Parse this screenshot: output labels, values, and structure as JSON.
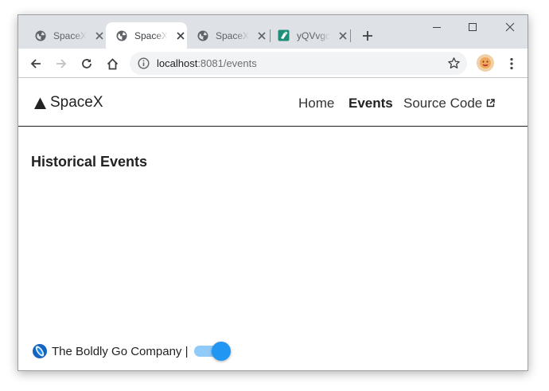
{
  "browser": {
    "tabs": [
      {
        "title": "SpaceX",
        "icon": "globe-icon",
        "active": false
      },
      {
        "title": "SpaceX",
        "icon": "globe-icon",
        "active": true
      },
      {
        "title": "SpaceX",
        "icon": "globe-icon",
        "active": false
      },
      {
        "title": "yQVvgc",
        "icon": "app-favicon-icon",
        "active": false
      }
    ],
    "url_host": "localhost",
    "url_rest": ":8081/events",
    "colors": {
      "tabstrip": "#dee1e6",
      "omnibox": "#f1f3f4"
    }
  },
  "site": {
    "brand": "SpaceX",
    "nav": [
      {
        "label": "Home",
        "active": false
      },
      {
        "label": "Events",
        "active": true
      },
      {
        "label": "Source Code",
        "active": false,
        "icon": "external-link-icon"
      }
    ],
    "heading": "Historical Events",
    "footer_text": "The Boldly Go Company |",
    "theme_toggle_on": true,
    "colors": {
      "accent": "#2196f3",
      "accent_light": "#90caf9",
      "text": "#222222"
    }
  }
}
